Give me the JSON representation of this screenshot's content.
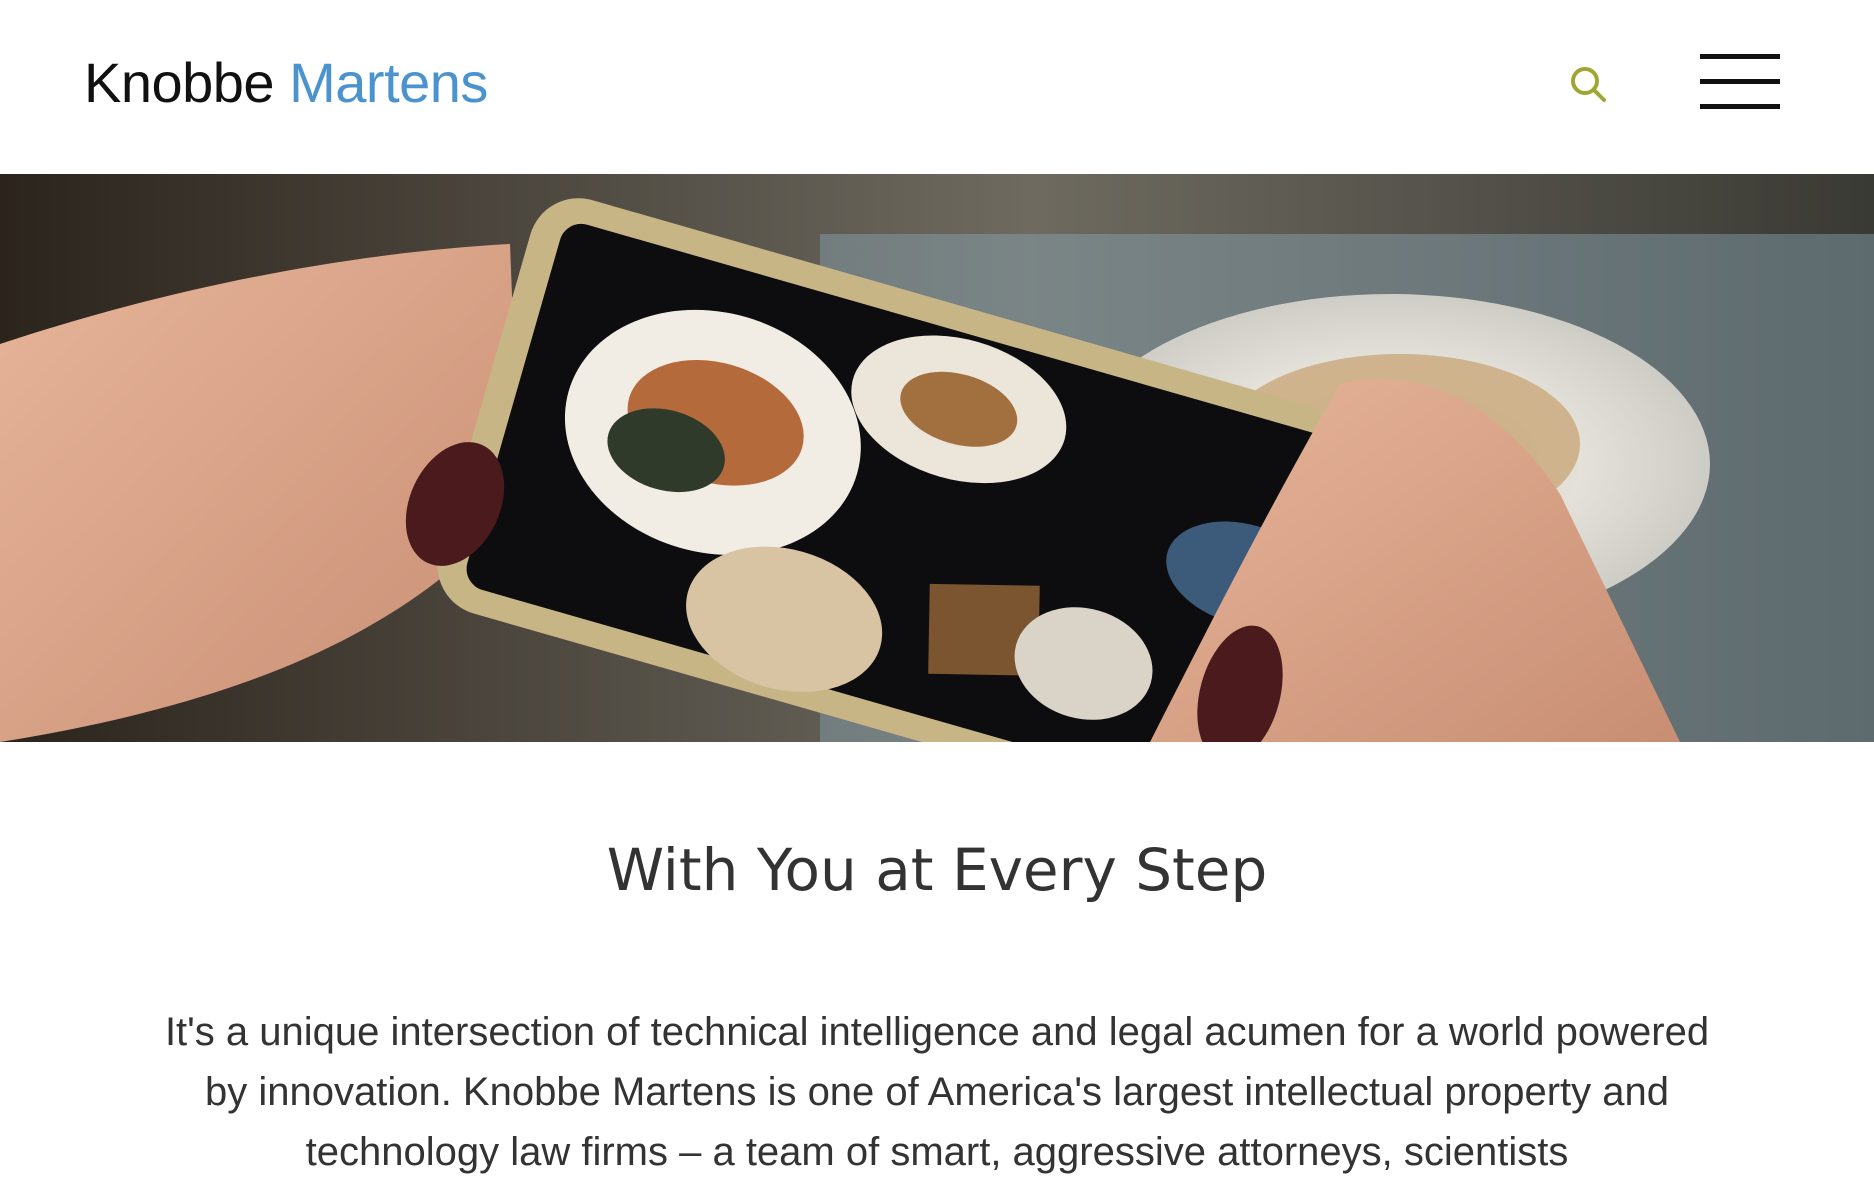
{
  "header": {
    "logo_word1": "Knobbe",
    "logo_word2": "Martens",
    "search_icon": "search-icon",
    "menu_icon": "hamburger-menu-icon"
  },
  "hero": {
    "image": "photo of hands holding a gold smartphone photographing plates of food on a table"
  },
  "intro": {
    "heading": "With You at Every Step",
    "body": "It's a unique intersection of technical intelligence and legal acumen for a world powered by innovation. Knobbe Martens is one of America's largest intellectual property and technology law firms – a team of smart, aggressive attorneys, scientists"
  },
  "colors": {
    "brand_blue": "#4a93cf",
    "search_icon": "#a0a632",
    "text_dark": "#333333"
  }
}
